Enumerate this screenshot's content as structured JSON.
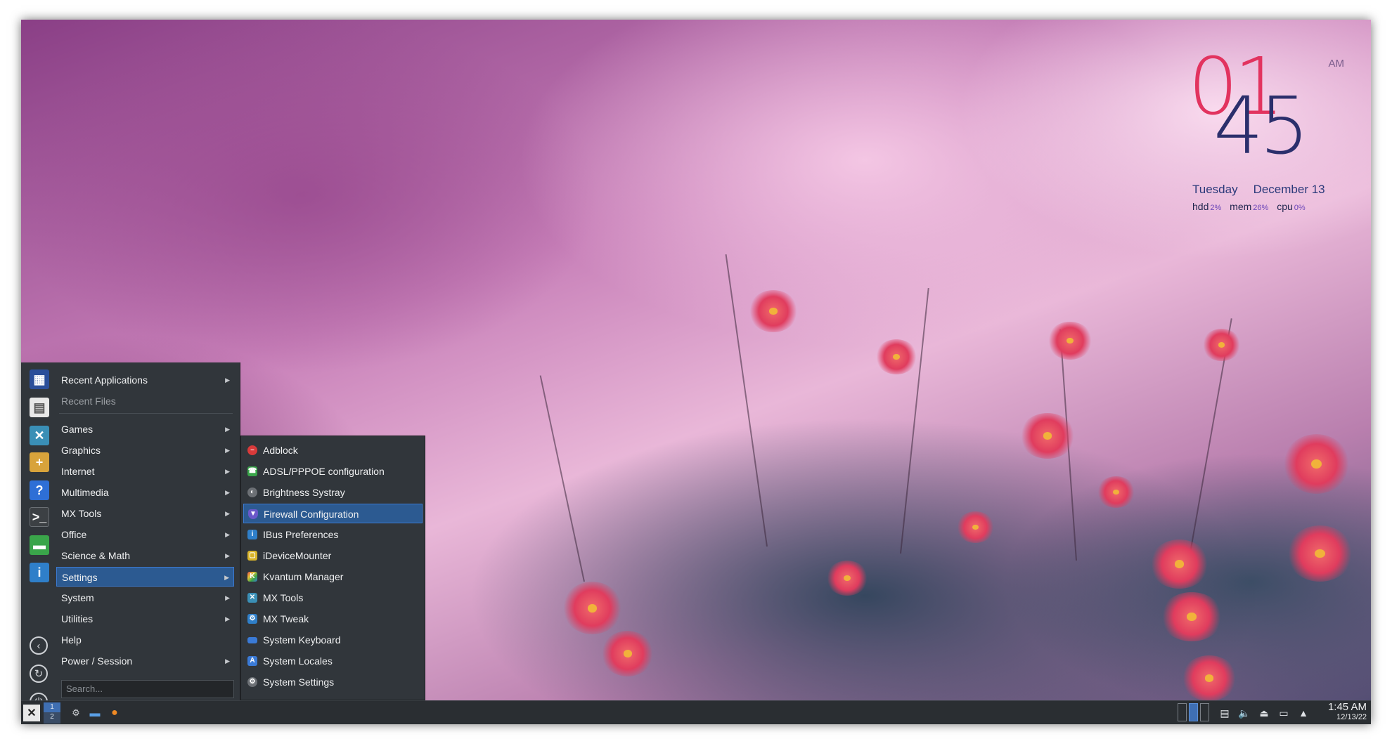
{
  "clock": {
    "hour": "01",
    "minute": "45",
    "ampm": "AM",
    "weekday": "Tuesday",
    "date": "December 13",
    "stats": [
      {
        "label": "hdd",
        "value": "2%"
      },
      {
        "label": "mem",
        "value": "26%"
      },
      {
        "label": "cpu",
        "value": "0%"
      }
    ]
  },
  "menu": {
    "recent_applications": "Recent Applications",
    "recent_files": "Recent Files",
    "categories": [
      "Games",
      "Graphics",
      "Internet",
      "Multimedia",
      "MX Tools",
      "Office",
      "Science & Math",
      "Settings",
      "System",
      "Utilities",
      "Help",
      "Power / Session"
    ],
    "search_placeholder": "Search..."
  },
  "submenu": {
    "items": [
      "Adblock",
      "ADSL/PPPOE configuration",
      "Brightness Systray",
      "Firewall Configuration",
      "IBus Preferences",
      "iDeviceMounter",
      "Kvantum Manager",
      "MX Tools",
      "MX Tweak",
      "System Keyboard",
      "System Locales",
      "System Settings"
    ],
    "selected": "Firewall Configuration"
  },
  "taskbar": {
    "pager": [
      "1",
      "2"
    ],
    "time": "1:45 AM",
    "date": "12/13/22"
  },
  "colors": {
    "menu_bg": "#31363b",
    "selection": "#2c5a91",
    "taskbar_bg": "#2a2e32",
    "clock_hour": "#e2335f",
    "clock_minute": "#2b2f6c"
  }
}
